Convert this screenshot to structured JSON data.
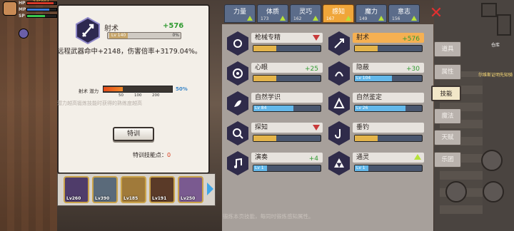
{
  "hud": {
    "level_text": "345884",
    "hp_label": "HP",
    "mp_label": "MP",
    "sp_label": "SP",
    "hp_fill": 0.9,
    "mp_fill": 0.75,
    "sp_fill": 0.6
  },
  "detail": {
    "skill_name": "射术",
    "bonus": "+576",
    "lv_text": "Lv 140",
    "xp_pct": "0%",
    "description": "远程武器命中+2148，伤害倍率+3179.04%。",
    "potential_label": "射术 潜力",
    "potential_ticks": [
      "50",
      "100",
      "200"
    ],
    "potential_pct": "50%",
    "potential_fill": 0.28,
    "hint": "潜力越高锻炼技能时获得的熟练度越高",
    "train_label": "特训",
    "train_points_label": "特训技能点：",
    "train_points_value": "0"
  },
  "party": {
    "heroes": [
      {
        "lv": "Lv260"
      },
      {
        "lv": "Lv390"
      },
      {
        "lv": "Lv185"
      },
      {
        "lv": "Lv191"
      },
      {
        "lv": "Lv250"
      }
    ]
  },
  "stats": [
    {
      "label": "力量",
      "value": ""
    },
    {
      "label": "体质",
      "value": "173"
    },
    {
      "label": "灵巧",
      "value": "162"
    },
    {
      "label": "感知",
      "value": "167"
    },
    {
      "label": "魔力",
      "value": "149"
    },
    {
      "label": "意志",
      "value": "156"
    }
  ],
  "skills_left": [
    {
      "name": "枪械专精",
      "bonus": "",
      "trend": "down",
      "lv": "",
      "fill": 0
    },
    {
      "name": "心眼",
      "bonus": "+25",
      "trend": "",
      "lv": "",
      "fill": 0
    },
    {
      "name": "自然学识",
      "bonus": "",
      "trend": "",
      "lv": "Lv 84",
      "fill": 0.6
    },
    {
      "name": "探知",
      "bonus": "",
      "trend": "down",
      "lv": "",
      "fill": 0
    },
    {
      "name": "演奏",
      "bonus": "+4",
      "trend": "",
      "lv": "Lv 1",
      "fill": 0.2
    }
  ],
  "skills_right": [
    {
      "name": "射术",
      "bonus": "+576",
      "trend": "",
      "lv": "",
      "fill": 0
    },
    {
      "name": "隐蔽",
      "bonus": "+30",
      "trend": "",
      "lv": "Lv 104",
      "fill": 0.55
    },
    {
      "name": "自然鉴定",
      "bonus": "",
      "trend": "",
      "lv": "Lv 26",
      "fill": 0.75
    },
    {
      "name": "垂钓",
      "bonus": "",
      "trend": "",
      "lv": "",
      "fill": 0
    },
    {
      "name": "通灵",
      "bonus": "",
      "trend": "up",
      "lv": "Lv 1",
      "fill": 0.2
    }
  ],
  "side_tabs": [
    "道具",
    "属性",
    "技能",
    "魔法",
    "天赋",
    "乐团"
  ],
  "bottom_hint": "锻炼本页技能，每同时锻炼感知属性。",
  "minimap_label": "仓库",
  "chain_text": "尔维斯证明先知骑"
}
